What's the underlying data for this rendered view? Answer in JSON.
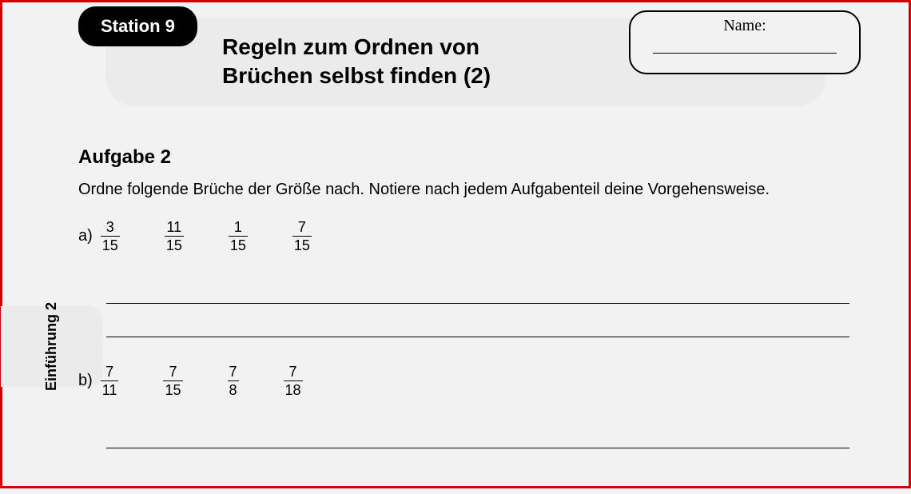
{
  "header": {
    "station_badge": "Station 9",
    "title_line1": "Regeln zum Ordnen von",
    "title_line2": "Brüchen selbst finden (2)",
    "name_label": "Name:"
  },
  "side_tab": "Einführung 2",
  "task": {
    "heading": "Aufgabe 2",
    "description": "Ordne folgende Brüche der Größe nach. Notiere nach jedem Aufgabenteil deine Vorgehensweise.",
    "subtasks": [
      {
        "letter": "a)",
        "fractions": [
          {
            "num": "3",
            "den": "15"
          },
          {
            "num": "11",
            "den": "15"
          },
          {
            "num": "1",
            "den": "15"
          },
          {
            "num": "7",
            "den": "15"
          }
        ]
      },
      {
        "letter": "b)",
        "fractions": [
          {
            "num": "7",
            "den": "11"
          },
          {
            "num": "7",
            "den": "15"
          },
          {
            "num": "7",
            "den": "8"
          },
          {
            "num": "7",
            "den": "18"
          }
        ]
      }
    ]
  }
}
